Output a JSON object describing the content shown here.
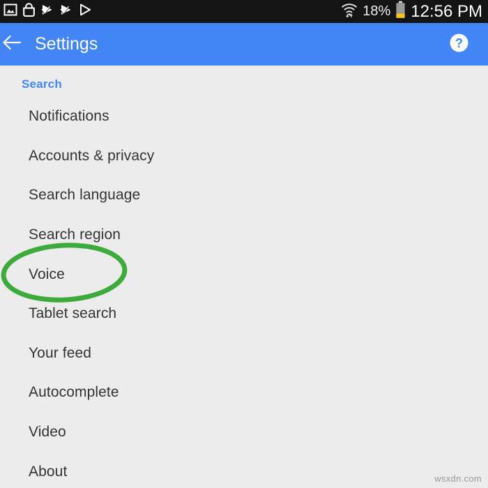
{
  "status_bar": {
    "background": "#141414",
    "left_icons": [
      {
        "name": "screenshot-icon",
        "label": "Screenshot captured"
      },
      {
        "name": "shopping-bag-icon",
        "label": "Play Store purchase"
      },
      {
        "name": "play-store-installed-icon",
        "label": "App installed"
      },
      {
        "name": "play-store-installed-icon-2",
        "label": "App installed"
      },
      {
        "name": "play-store-icon",
        "label": "Play Store"
      }
    ],
    "wifi_icon": "wifi-with-transfer-arrows-icon",
    "battery_percent": "18%",
    "battery_icon": "battery-low-icon",
    "battery_fill_color": "#f5c518",
    "clock": "12:56 PM"
  },
  "app_bar": {
    "background": "#4285f4",
    "back_icon": "arrow-left-icon",
    "title": "Settings",
    "help_icon": "help-circle-icon"
  },
  "content": {
    "background": "#ececec",
    "section_header": "Search",
    "section_header_color": "#4286f4",
    "items": [
      {
        "label": "Notifications"
      },
      {
        "label": "Accounts & privacy"
      },
      {
        "label": "Search language"
      },
      {
        "label": "Search region"
      },
      {
        "label": "Voice",
        "highlighted": true
      },
      {
        "label": "Tablet search"
      },
      {
        "label": "Your feed"
      },
      {
        "label": "Autocomplete"
      },
      {
        "label": "Video"
      },
      {
        "label": "About"
      }
    ]
  },
  "annotation": {
    "shape": "ellipse",
    "target_label": "Voice",
    "color": "#3cab3c",
    "stroke_width": 7
  },
  "watermark": {
    "text": "wsxdn.com",
    "color": "#9a9a9a"
  }
}
